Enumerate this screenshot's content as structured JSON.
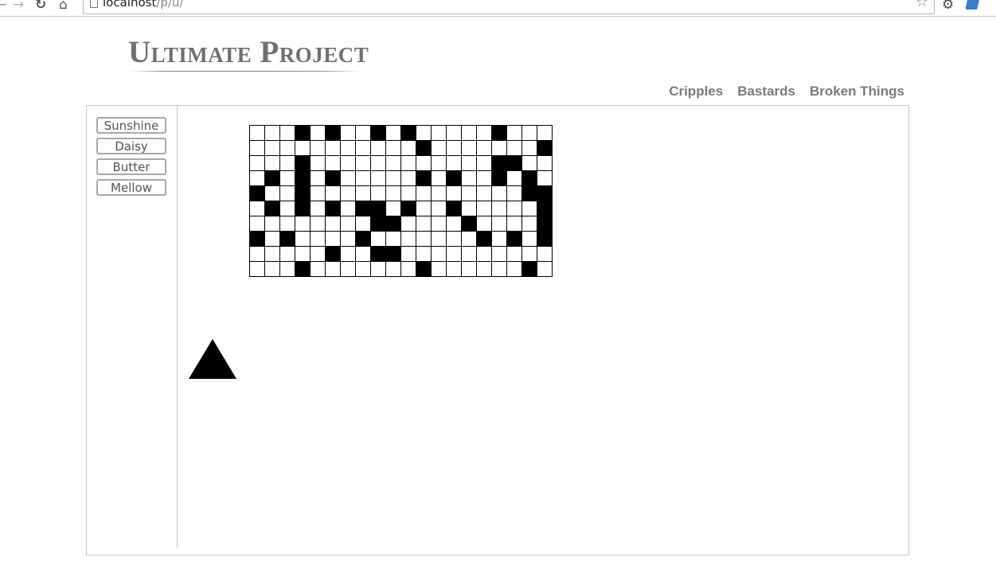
{
  "browser": {
    "url_host": "localhost",
    "url_path": "/p/u/",
    "icons": [
      "back-arrow-icon",
      "forward-arrow-icon",
      "reload-icon",
      "home-icon",
      "page-icon",
      "bookmark-star-icon",
      "extension-icon",
      "extension-icon"
    ]
  },
  "header": {
    "site_title": "Ultimate Project"
  },
  "nav": {
    "items": [
      {
        "label": "Cripples"
      },
      {
        "label": "Bastards"
      },
      {
        "label": "Broken Things"
      }
    ]
  },
  "sidebar": {
    "buttons": [
      {
        "label": "Sunshine"
      },
      {
        "label": "Daisy"
      },
      {
        "label": "Butter"
      },
      {
        "label": "Mellow"
      }
    ]
  },
  "grid": {
    "columns": 20,
    "rows": 10,
    "filled_color": "#000000",
    "empty_color": "#ffffff",
    "cells": [
      "00010100101000001000",
      "00000000000100000001",
      "00010000000000001100",
      "01010100000101001010",
      "10010000000000000011",
      "01010101101001000001",
      "00000000110000100001",
      "10100001000000010101",
      "00000100110000000000",
      "00010000000100000010"
    ]
  },
  "shape": {
    "type": "triangle",
    "color": "#000000"
  }
}
